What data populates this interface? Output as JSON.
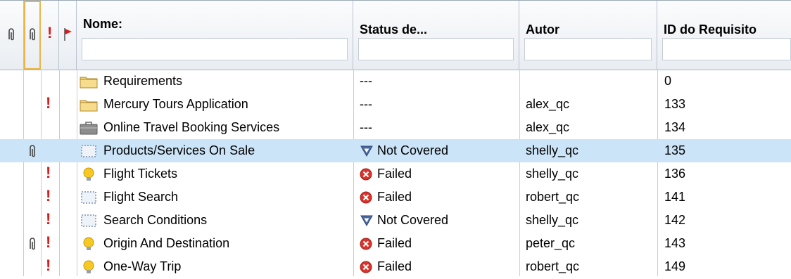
{
  "columns": {
    "name": "Nome:",
    "status": "Status de...",
    "author": "Autor",
    "req_id": "ID do Requisito"
  },
  "rows": [
    {
      "name": "Requirements",
      "status": "---",
      "author": "",
      "id": "0",
      "icon": "folder-icon",
      "status_icon": "",
      "attachment": false,
      "flag": false
    },
    {
      "name": "Mercury Tours Application",
      "status": "---",
      "author": "alex_qc",
      "id": "133",
      "icon": "folder-icon",
      "status_icon": "",
      "attachment": false,
      "flag": true
    },
    {
      "name": "Online Travel Booking Services",
      "status": "---",
      "author": "alex_qc",
      "id": "134",
      "icon": "briefcase-icon",
      "status_icon": "",
      "attachment": false,
      "flag": false
    },
    {
      "name": "Products/Services On Sale",
      "status": "Not Covered",
      "author": "shelly_qc",
      "id": "135",
      "icon": "dotted-box-icon",
      "status_icon": "not-covered-icon",
      "attachment": true,
      "flag": false
    },
    {
      "name": "Flight Tickets",
      "status": "Failed",
      "author": "shelly_qc",
      "id": "136",
      "icon": "lightbulb-icon",
      "status_icon": "failed-icon",
      "attachment": false,
      "flag": true
    },
    {
      "name": "Flight Search",
      "status": "Failed",
      "author": "robert_qc",
      "id": "141",
      "icon": "dotted-box-icon",
      "status_icon": "failed-icon",
      "attachment": false,
      "flag": true
    },
    {
      "name": "Search Conditions",
      "status": "Not Covered",
      "author": "shelly_qc",
      "id": "142",
      "icon": "dotted-box-icon",
      "status_icon": "not-covered-icon",
      "attachment": false,
      "flag": true
    },
    {
      "name": "Origin And Destination",
      "status": "Failed",
      "author": "peter_qc",
      "id": "143",
      "icon": "lightbulb-icon",
      "status_icon": "failed-icon",
      "attachment": true,
      "flag": true
    },
    {
      "name": "One-Way Trip",
      "status": "Failed",
      "author": "robert_qc",
      "id": "149",
      "icon": "lightbulb-icon",
      "status_icon": "failed-icon",
      "attachment": false,
      "flag": true
    }
  ],
  "selected_row": 3,
  "colors": {
    "selected": "#cce4f7",
    "failed": "#d9342b",
    "not_covered": "#3f5f8f",
    "flag": "#d81c1c",
    "folder": "#e9c25a"
  }
}
